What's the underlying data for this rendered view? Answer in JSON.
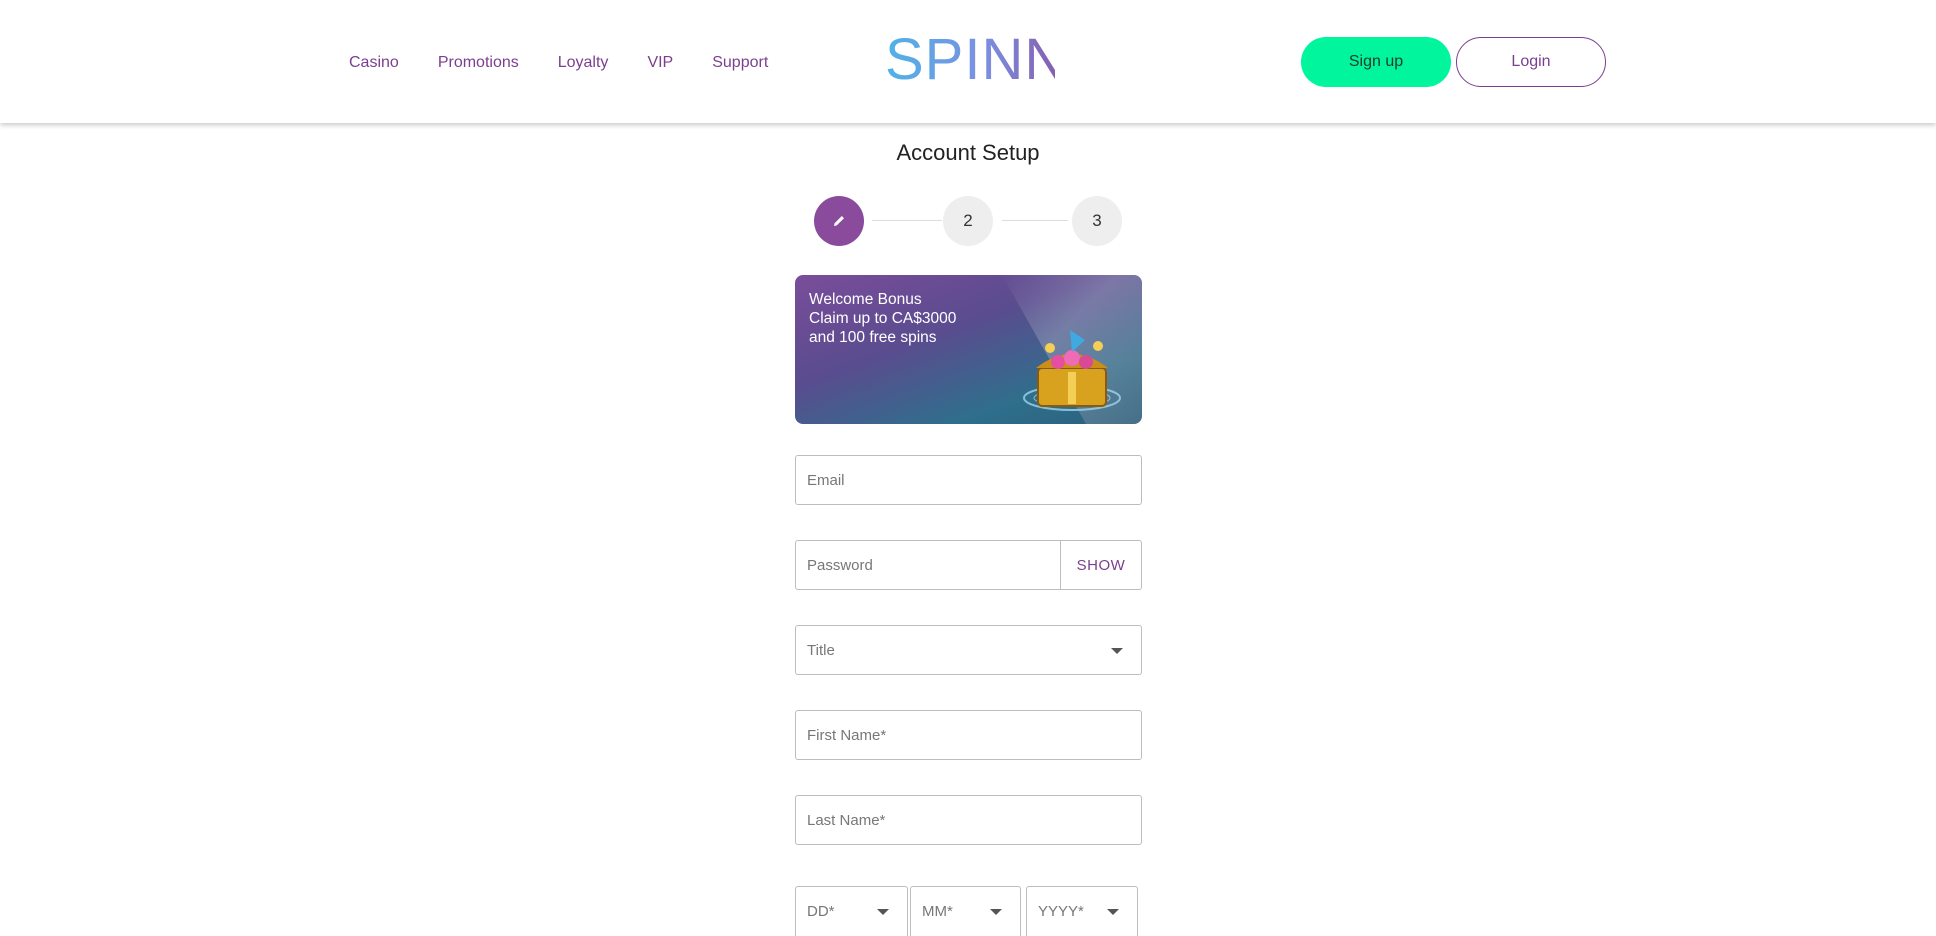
{
  "header": {
    "nav": [
      "Casino",
      "Promotions",
      "Loyalty",
      "VIP",
      "Support"
    ],
    "logo_text": "SPINNI",
    "signup_label": "Sign up",
    "login_label": "Login"
  },
  "page": {
    "title": "Account Setup"
  },
  "stepper": {
    "steps": [
      "",
      "2",
      "3"
    ],
    "active_step_icon": "pencil-icon"
  },
  "banner": {
    "line1": "Welcome Bonus",
    "line2": "Claim up to CA$3000",
    "line3": "and 100 free spins"
  },
  "form": {
    "email_placeholder": "Email",
    "password_placeholder": "Password",
    "show_label": "SHOW",
    "title_placeholder": "Title",
    "first_name_placeholder": "First Name*",
    "last_name_placeholder": "Last Name*",
    "dob_day_placeholder": "DD*",
    "dob_month_placeholder": "MM*",
    "dob_year_placeholder": "YYYY*"
  },
  "colors": {
    "brand_purple": "#7b3f8f",
    "signup_green": "#00f59d",
    "active_step": "#8a4b9c"
  }
}
